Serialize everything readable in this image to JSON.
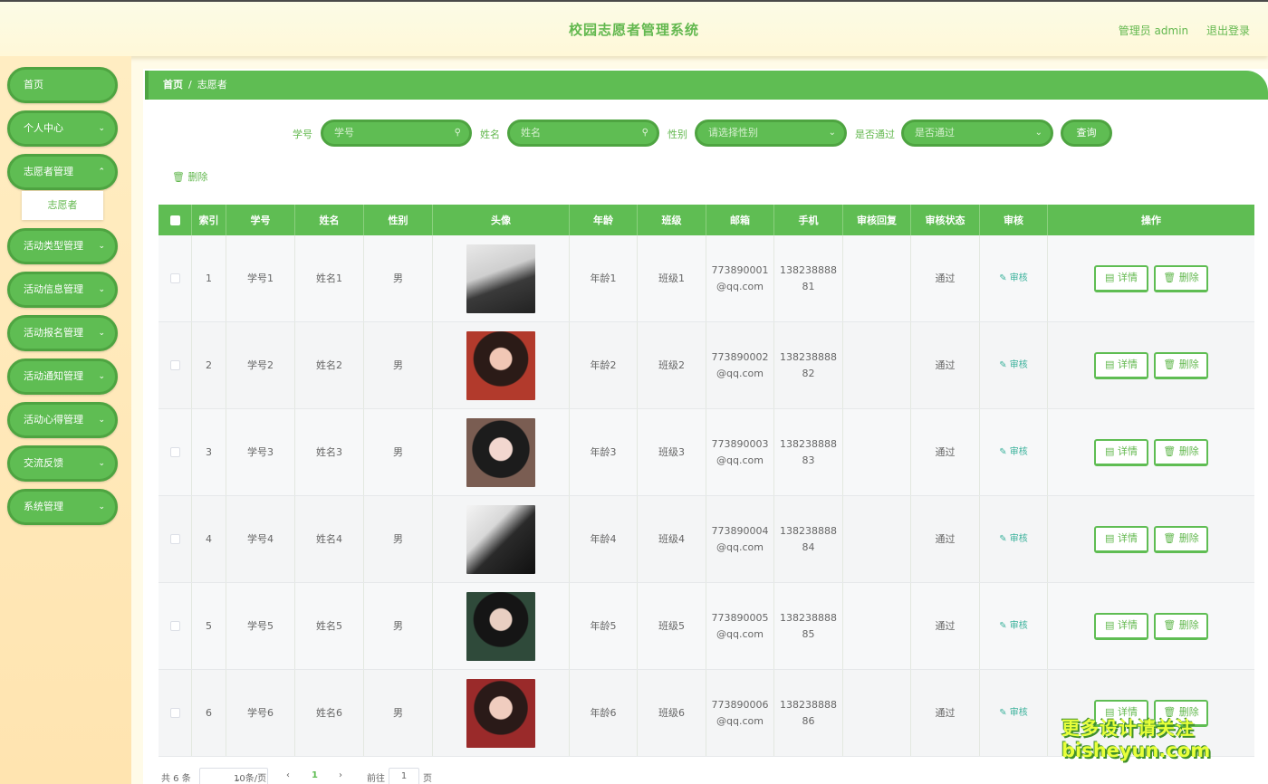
{
  "header": {
    "title": "校园志愿者管理系统",
    "user": "管理员 admin",
    "logout": "退出登录"
  },
  "sidebar": {
    "items": [
      {
        "label": "首页",
        "has_children": false
      },
      {
        "label": "个人中心",
        "has_children": true
      },
      {
        "label": "志愿者管理",
        "has_children": true
      },
      {
        "label": "活动类型管理",
        "has_children": true
      },
      {
        "label": "活动信息管理",
        "has_children": true
      },
      {
        "label": "活动报名管理",
        "has_children": true
      },
      {
        "label": "活动通知管理",
        "has_children": true
      },
      {
        "label": "活动心得管理",
        "has_children": true
      },
      {
        "label": "交流反馈",
        "has_children": true
      },
      {
        "label": "系统管理",
        "has_children": true
      }
    ],
    "active_sub": "志愿者"
  },
  "breadcrumb": {
    "home": "首页",
    "sep": "/",
    "current": "志愿者"
  },
  "search": {
    "id_label": "学号",
    "id_placeholder": "学号",
    "name_label": "姓名",
    "name_placeholder": "姓名",
    "gender_label": "性别",
    "gender_placeholder": "请选择性别",
    "passed_label": "是否通过",
    "passed_placeholder": "是否通过",
    "query": "查询"
  },
  "bulk_delete": "删除",
  "table": {
    "columns": [
      "",
      "索引",
      "学号",
      "姓名",
      "性别",
      "头像",
      "年龄",
      "班级",
      "邮箱",
      "手机",
      "审核回复",
      "审核状态",
      "审核",
      "操作"
    ],
    "audit_label": "审核",
    "detail_label": "详情",
    "delete_label": "删除",
    "rows": [
      {
        "index": "1",
        "student_id": "学号1",
        "name": "姓名1",
        "gender": "男",
        "age": "年龄1",
        "class": "班级1",
        "email_a": "773890001",
        "email_b": "@qq.com",
        "phone_a": "138238888",
        "phone_b": "81",
        "reply": "",
        "status": "通过"
      },
      {
        "index": "2",
        "student_id": "学号2",
        "name": "姓名2",
        "gender": "男",
        "age": "年龄2",
        "class": "班级2",
        "email_a": "773890002",
        "email_b": "@qq.com",
        "phone_a": "138238888",
        "phone_b": "82",
        "reply": "",
        "status": "通过"
      },
      {
        "index": "3",
        "student_id": "学号3",
        "name": "姓名3",
        "gender": "男",
        "age": "年龄3",
        "class": "班级3",
        "email_a": "773890003",
        "email_b": "@qq.com",
        "phone_a": "138238888",
        "phone_b": "83",
        "reply": "",
        "status": "通过"
      },
      {
        "index": "4",
        "student_id": "学号4",
        "name": "姓名4",
        "gender": "男",
        "age": "年龄4",
        "class": "班级4",
        "email_a": "773890004",
        "email_b": "@qq.com",
        "phone_a": "138238888",
        "phone_b": "84",
        "reply": "",
        "status": "通过"
      },
      {
        "index": "5",
        "student_id": "学号5",
        "name": "姓名5",
        "gender": "男",
        "age": "年龄5",
        "class": "班级5",
        "email_a": "773890005",
        "email_b": "@qq.com",
        "phone_a": "138238888",
        "phone_b": "85",
        "reply": "",
        "status": "通过"
      },
      {
        "index": "6",
        "student_id": "学号6",
        "name": "姓名6",
        "gender": "男",
        "age": "年龄6",
        "class": "班级6",
        "email_a": "773890006",
        "email_b": "@qq.com",
        "phone_a": "138238888",
        "phone_b": "86",
        "reply": "",
        "status": "通过"
      }
    ]
  },
  "pagination": {
    "total": "共 6 条",
    "page_size": "10条/页",
    "current_page": "1",
    "goto_label": "前往",
    "goto_value": "1",
    "page_unit": "页"
  },
  "watermark": {
    "line1": "更多设计请关注",
    "line2": "bisheyun.com"
  },
  "colors": {
    "primary": "#5fbd53",
    "primary_dark": "#4ea441",
    "sidebar_bg": "#ffedc2",
    "header_bg": "#fbfbe6",
    "audit_link": "#3ab19b",
    "watermark": "#e8ff3a"
  },
  "icons": {
    "search": "search-icon",
    "dropdown": "chevron-down-icon",
    "delete": "trash-icon",
    "detail": "document-icon",
    "audit": "edit-icon",
    "prev": "chevron-left-icon",
    "next": "chevron-right-icon"
  }
}
